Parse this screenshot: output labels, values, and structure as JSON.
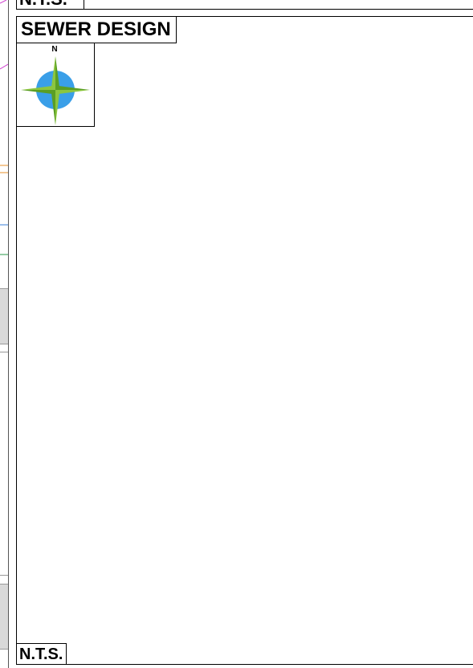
{
  "top_panel": {
    "scale_label": "N.T.S."
  },
  "sewer_panel": {
    "title": "SEWER DESIGN",
    "north_label": "N",
    "scale_label": "N.T.S."
  },
  "colors": {
    "compass_blue": "#3a9fe8",
    "compass_green": "#8cc63f",
    "compass_green_dark": "#5a9e24",
    "strip_orange": "#e8902a",
    "strip_blue": "#3a7fd8",
    "strip_green": "#2a9a4a",
    "strip_magenta": "#d040d0",
    "strip_gray": "#d9d9d9"
  }
}
